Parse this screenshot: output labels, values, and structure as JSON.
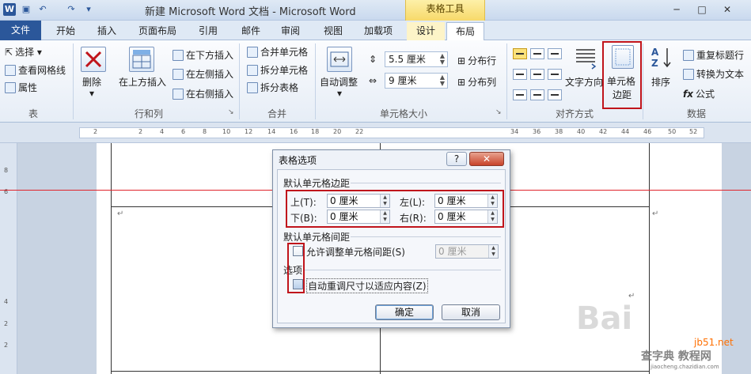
{
  "titlebar": {
    "title": "新建 Microsoft Word 文档 - Microsoft Word",
    "context_tools": "表格工具",
    "app_icon": "W"
  },
  "tabs": [
    "文件",
    "开始",
    "插入",
    "页面布局",
    "引用",
    "邮件",
    "审阅",
    "视图",
    "加载项",
    "设计",
    "布局"
  ],
  "ribbon": {
    "table_group": {
      "select": "选择 ▾",
      "view_gridlines": "查看网格线",
      "properties": "属性",
      "label": "表"
    },
    "rows_cols_group": {
      "delete": "删除",
      "insert_above": "在上方插入",
      "insert_below": "在下方插入",
      "insert_left": "在左侧插入",
      "insert_right": "在右侧插入",
      "label": "行和列"
    },
    "merge_group": {
      "merge_cells": "合并单元格",
      "split_cells": "拆分单元格",
      "split_table": "拆分表格",
      "label": "合并"
    },
    "cell_size_group": {
      "autofit": "自动调整",
      "height": "5.5 厘米",
      "width": "9 厘米",
      "distribute_rows": "分布行",
      "distribute_cols": "分布列",
      "label": "单元格大小"
    },
    "alignment_group": {
      "text_direction": "文字方向",
      "cell_margins_line1": "单元格",
      "cell_margins_line2": "边距",
      "label": "对齐方式"
    },
    "data_group": {
      "sort": "排序",
      "repeat_header": "重复标题行",
      "convert_to_text": "转换为文本",
      "formula": "公式",
      "label": "数据"
    }
  },
  "ruler": {
    "ticks": [
      "2",
      "2",
      "4",
      "6",
      "8",
      "10",
      "12",
      "14",
      "16",
      "18",
      "20",
      "22",
      "34",
      "36",
      "38",
      "40",
      "42",
      "44",
      "46",
      "50",
      "52"
    ],
    "left_ticks": [
      "8",
      "6",
      "4",
      "2",
      "2"
    ]
  },
  "dialog": {
    "title": "表格选项",
    "help": "?",
    "close": "✕",
    "margins_section": "默认单元格边距",
    "top_label": "上(T):",
    "top_value": "0 厘米",
    "left_label": "左(L):",
    "left_value": "0 厘米",
    "bottom_label": "下(B):",
    "bottom_value": "0 厘米",
    "right_label": "右(R):",
    "right_value": "0 厘米",
    "spacing_section": "默认单元格间距",
    "allow_spacing": "允许调整单元格间距(S)",
    "spacing_value": "0 厘米",
    "options_section": "选项",
    "autoresize": "自动重调尺寸以适应内容(Z)",
    "ok": "确定",
    "cancel": "取消"
  },
  "watermark": {
    "text": "Bai",
    "site1": "jb51.net",
    "site2": "查字典 教程网",
    "site3": "jiaocheng.chazidian.com"
  },
  "colors": {
    "file_tab": "#2b579a",
    "highlight": "#c0141b",
    "guide_line": "#e0242b"
  }
}
